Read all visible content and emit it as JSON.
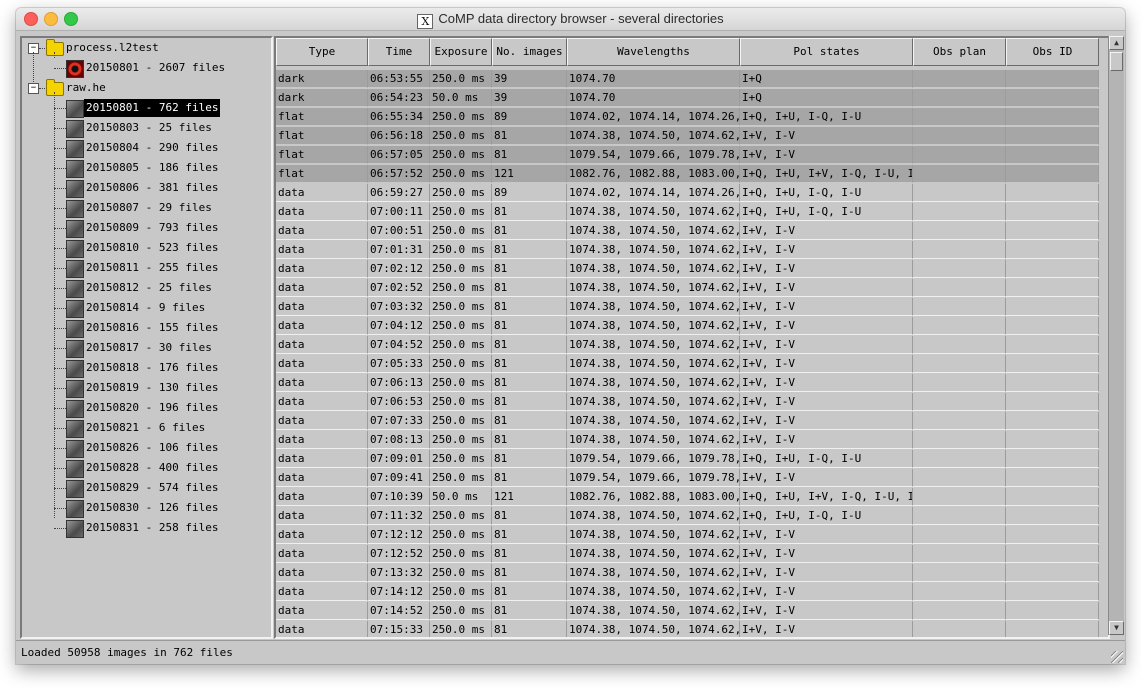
{
  "window": {
    "title": "CoMP data directory browser - several directories",
    "title_icon": "X"
  },
  "tree": {
    "roots": [
      {
        "label": "process.l2test",
        "expander": "−",
        "children": [
          {
            "label": "20150801 - 2607 files",
            "icon": "red-file-icon",
            "selected": false
          }
        ]
      },
      {
        "label": "raw.he",
        "expander": "−",
        "children": [
          {
            "label": "20150801 - 762 files",
            "selected": true
          },
          {
            "label": "20150803 - 25 files"
          },
          {
            "label": "20150804 - 290 files"
          },
          {
            "label": "20150805 - 186 files"
          },
          {
            "label": "20150806 - 381 files"
          },
          {
            "label": "20150807 - 29 files"
          },
          {
            "label": "20150809 - 793 files"
          },
          {
            "label": "20150810 - 523 files"
          },
          {
            "label": "20150811 - 255 files"
          },
          {
            "label": "20150812 - 25 files"
          },
          {
            "label": "20150814 - 9 files"
          },
          {
            "label": "20150816 - 155 files"
          },
          {
            "label": "20150817 - 30 files"
          },
          {
            "label": "20150818 - 176 files"
          },
          {
            "label": "20150819 - 130 files"
          },
          {
            "label": "20150820 - 196 files"
          },
          {
            "label": "20150821 - 6 files"
          },
          {
            "label": "20150826 - 106 files"
          },
          {
            "label": "20150828 - 400 files"
          },
          {
            "label": "20150829 - 574 files"
          },
          {
            "label": "20150830 - 126 files"
          },
          {
            "label": "20150831 - 258 files"
          }
        ]
      }
    ]
  },
  "table": {
    "columns": [
      "Type",
      "Time",
      "Exposure",
      "No. images",
      "Wavelengths",
      "Pol states",
      "Obs plan",
      "Obs ID"
    ],
    "rows": [
      [
        "dark",
        "06:53:55",
        "250.0 ms",
        "39",
        "1074.70",
        "I+Q",
        "",
        ""
      ],
      [
        "dark",
        "06:54:23",
        "50.0 ms",
        "39",
        "1074.70",
        "I+Q",
        "",
        ""
      ],
      [
        "flat",
        "06:55:34",
        "250.0 ms",
        "89",
        "1074.02, 1074.14, 1074.26, 10",
        "I+Q, I+U, I-Q, I-U",
        "",
        ""
      ],
      [
        "flat",
        "06:56:18",
        "250.0 ms",
        "81",
        "1074.38, 1074.50, 1074.62, 10",
        "I+V, I-V",
        "",
        ""
      ],
      [
        "flat",
        "06:57:05",
        "250.0 ms",
        "81",
        "1079.54, 1079.66, 1079.78, 10",
        "I+V, I-V",
        "",
        ""
      ],
      [
        "flat",
        "06:57:52",
        "250.0 ms",
        "121",
        "1082.76, 1082.88, 1083.00, 10",
        "I+Q, I+U, I+V, I-Q, I-U, I-V",
        "",
        ""
      ],
      [
        "data",
        "06:59:27",
        "250.0 ms",
        "89",
        "1074.02, 1074.14, 1074.26, 10",
        "I+Q, I+U, I-Q, I-U",
        "",
        ""
      ],
      [
        "data",
        "07:00:11",
        "250.0 ms",
        "81",
        "1074.38, 1074.50, 1074.62, 10",
        "I+Q, I+U, I-Q, I-U",
        "",
        ""
      ],
      [
        "data",
        "07:00:51",
        "250.0 ms",
        "81",
        "1074.38, 1074.50, 1074.62, 10",
        "I+V, I-V",
        "",
        ""
      ],
      [
        "data",
        "07:01:31",
        "250.0 ms",
        "81",
        "1074.38, 1074.50, 1074.62, 10",
        "I+V, I-V",
        "",
        ""
      ],
      [
        "data",
        "07:02:12",
        "250.0 ms",
        "81",
        "1074.38, 1074.50, 1074.62, 10",
        "I+V, I-V",
        "",
        ""
      ],
      [
        "data",
        "07:02:52",
        "250.0 ms",
        "81",
        "1074.38, 1074.50, 1074.62, 10",
        "I+V, I-V",
        "",
        ""
      ],
      [
        "data",
        "07:03:32",
        "250.0 ms",
        "81",
        "1074.38, 1074.50, 1074.62, 10",
        "I+V, I-V",
        "",
        ""
      ],
      [
        "data",
        "07:04:12",
        "250.0 ms",
        "81",
        "1074.38, 1074.50, 1074.62, 10",
        "I+V, I-V",
        "",
        ""
      ],
      [
        "data",
        "07:04:52",
        "250.0 ms",
        "81",
        "1074.38, 1074.50, 1074.62, 10",
        "I+V, I-V",
        "",
        ""
      ],
      [
        "data",
        "07:05:33",
        "250.0 ms",
        "81",
        "1074.38, 1074.50, 1074.62, 10",
        "I+V, I-V",
        "",
        ""
      ],
      [
        "data",
        "07:06:13",
        "250.0 ms",
        "81",
        "1074.38, 1074.50, 1074.62, 10",
        "I+V, I-V",
        "",
        ""
      ],
      [
        "data",
        "07:06:53",
        "250.0 ms",
        "81",
        "1074.38, 1074.50, 1074.62, 10",
        "I+V, I-V",
        "",
        ""
      ],
      [
        "data",
        "07:07:33",
        "250.0 ms",
        "81",
        "1074.38, 1074.50, 1074.62, 10",
        "I+V, I-V",
        "",
        ""
      ],
      [
        "data",
        "07:08:13",
        "250.0 ms",
        "81",
        "1074.38, 1074.50, 1074.62, 10",
        "I+V, I-V",
        "",
        ""
      ],
      [
        "data",
        "07:09:01",
        "250.0 ms",
        "81",
        "1079.54, 1079.66, 1079.78, 10",
        "I+Q, I+U, I-Q, I-U",
        "",
        ""
      ],
      [
        "data",
        "07:09:41",
        "250.0 ms",
        "81",
        "1079.54, 1079.66, 1079.78, 10",
        "I+V, I-V",
        "",
        ""
      ],
      [
        "data",
        "07:10:39",
        "50.0 ms",
        "121",
        "1082.76, 1082.88, 1083.00, 10",
        "I+Q, I+U, I+V, I-Q, I-U, I-V",
        "",
        ""
      ],
      [
        "data",
        "07:11:32",
        "250.0 ms",
        "81",
        "1074.38, 1074.50, 1074.62, 10",
        "I+Q, I+U, I-Q, I-U",
        "",
        ""
      ],
      [
        "data",
        "07:12:12",
        "250.0 ms",
        "81",
        "1074.38, 1074.50, 1074.62, 10",
        "I+V, I-V",
        "",
        ""
      ],
      [
        "data",
        "07:12:52",
        "250.0 ms",
        "81",
        "1074.38, 1074.50, 1074.62, 10",
        "I+V, I-V",
        "",
        ""
      ],
      [
        "data",
        "07:13:32",
        "250.0 ms",
        "81",
        "1074.38, 1074.50, 1074.62, 10",
        "I+V, I-V",
        "",
        ""
      ],
      [
        "data",
        "07:14:12",
        "250.0 ms",
        "81",
        "1074.38, 1074.50, 1074.62, 10",
        "I+V, I-V",
        "",
        ""
      ],
      [
        "data",
        "07:14:52",
        "250.0 ms",
        "81",
        "1074.38, 1074.50, 1074.62, 10",
        "I+V, I-V",
        "",
        ""
      ],
      [
        "data",
        "07:15:33",
        "250.0 ms",
        "81",
        "1074.38, 1074.50, 1074.62, 10",
        "I+V, I-V",
        "",
        ""
      ]
    ]
  },
  "status": {
    "text": "Loaded 50958 images in 762 files"
  },
  "colors": {
    "calibration_row": "#a6a6a6",
    "data_row": "#c8c8c8",
    "selection": "#000000"
  }
}
